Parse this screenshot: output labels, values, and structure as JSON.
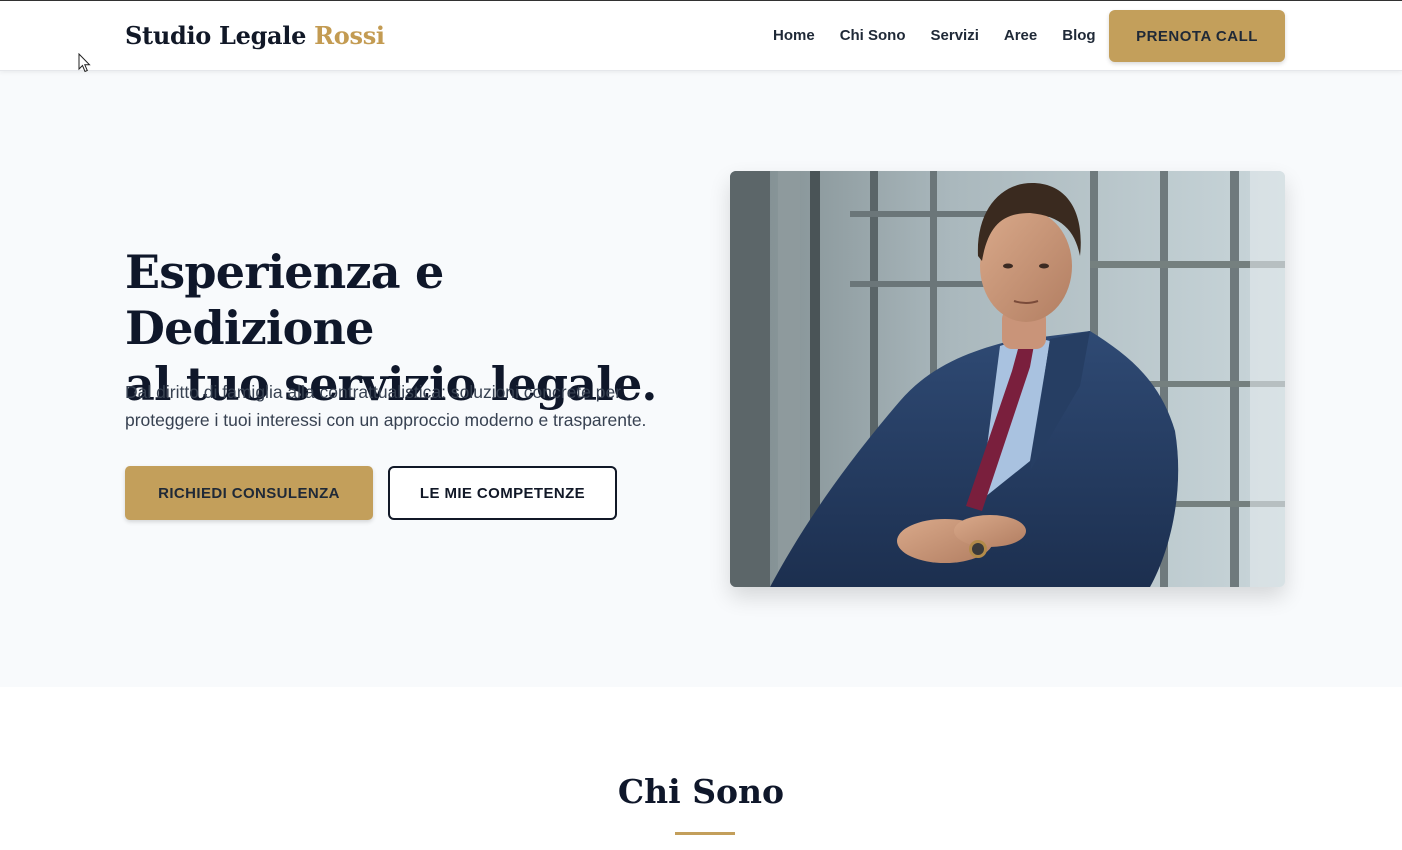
{
  "brand": {
    "name": "Studio Legale",
    "accent": "Rossi",
    "accent_color": "#c39f5b"
  },
  "nav": {
    "items": [
      {
        "label": "Home"
      },
      {
        "label": "Chi Sono"
      },
      {
        "label": "Servizi"
      },
      {
        "label": "Aree"
      },
      {
        "label": "Blog"
      }
    ],
    "cta": "PRENOTA CALL"
  },
  "hero": {
    "title_line1": "Esperienza e Dedizione",
    "title_line2": "al tuo servizio legale.",
    "subtitle_line1": "Dal diritto di famiglia alla contrattualistica: soluzioni concrete per",
    "subtitle_line2": "proteggere i tuoi interessi con un approccio moderno e trasparente.",
    "primary_button": "RICHIEDI CONSULENZA",
    "secondary_button": "LE MIE COMPETENZE"
  },
  "about": {
    "title": "Chi Sono"
  },
  "icons": {
    "cursor": "mouse-pointer-icon"
  }
}
